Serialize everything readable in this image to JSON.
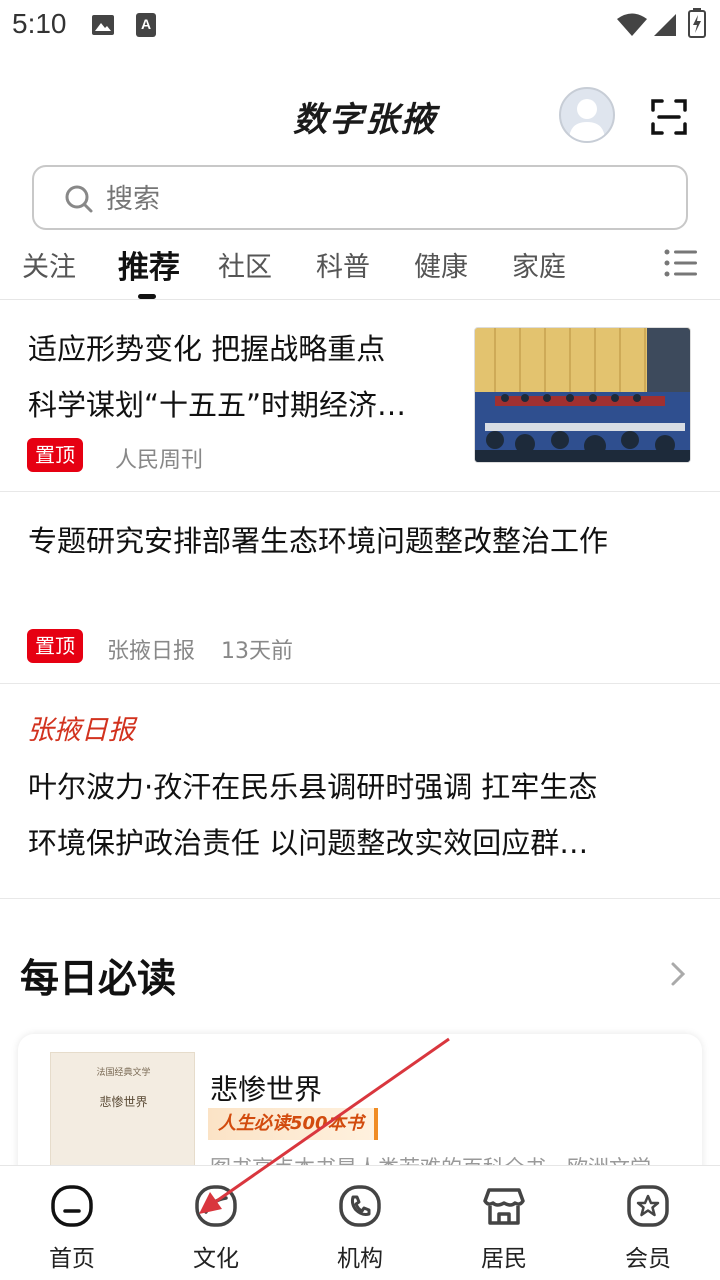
{
  "status_bar": {
    "time": "5:10"
  },
  "header": {
    "title": "数字张掖"
  },
  "search": {
    "placeholder": "搜索"
  },
  "tabs": [
    {
      "label": "关注"
    },
    {
      "label": "推荐",
      "active": true
    },
    {
      "label": "社区"
    },
    {
      "label": "科普"
    },
    {
      "label": "健康"
    },
    {
      "label": "家庭"
    }
  ],
  "news": [
    {
      "title_line1": "适应形势变化  把握战略重点",
      "title_line2": "科学谋划“十五五”时期经济…",
      "badge": "置顶",
      "source": "人民周刊"
    },
    {
      "title": "专题研究安排部署生态环境问题整改整治工作",
      "badge": "置顶",
      "source": "张掖日报",
      "time": "13天前"
    },
    {
      "source": "张掖日报",
      "title_line1": "叶尔波力·孜汗在民乐县调研时强调 扛牢生态",
      "title_line2": "环境保护政治责任   以问题整改实效回应群…"
    }
  ],
  "daily": {
    "title": "每日必读",
    "book": {
      "cover_small": "法国经典文学",
      "cover_title": "悲惨世界",
      "title": "悲惨世界",
      "tag": "人生必读500本书",
      "desc": "图书高点本书是人类若难的百科全书，欧洲文学"
    }
  },
  "bottom_nav": [
    {
      "label": "首页"
    },
    {
      "label": "文化"
    },
    {
      "label": "机构"
    },
    {
      "label": "居民"
    },
    {
      "label": "会员"
    }
  ],
  "colors": {
    "accent_red": "#e60012",
    "source_red": "#d2321e",
    "tag_orange": "#f08c24",
    "arrow_red": "#d9363e"
  }
}
